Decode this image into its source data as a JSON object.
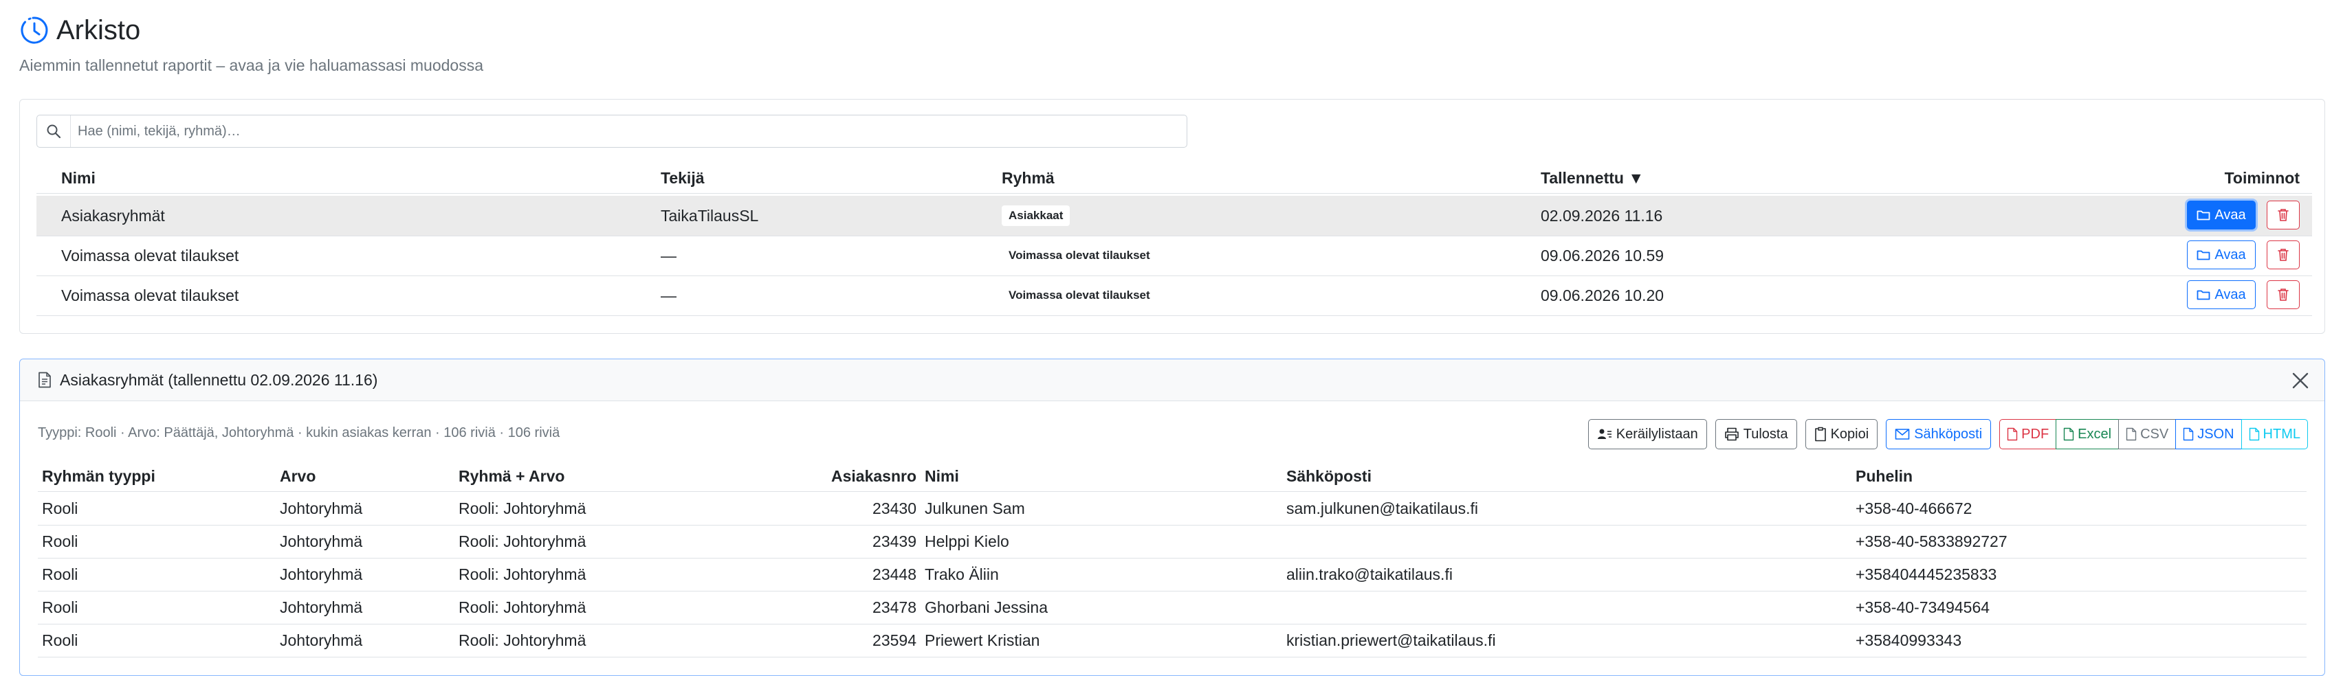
{
  "page": {
    "title": "Arkisto",
    "subtitle": "Aiemmin tallennetut raportit – avaa ja vie haluamassasi muodossa"
  },
  "search": {
    "placeholder": "Hae (nimi, tekijä, ryhmä)…",
    "value": ""
  },
  "archive_table": {
    "headers": {
      "name": "Nimi",
      "author": "Tekijä",
      "group": "Ryhmä",
      "saved": "Tallennettu ▼",
      "actions": "Toiminnot"
    },
    "open_label": "Avaa",
    "rows": [
      {
        "name": "Asiakasryhmät",
        "author": "TaikaTilausSL",
        "group": "Asiakkaat",
        "saved": "02.09.2026 11.16",
        "selected": true
      },
      {
        "name": "Voimassa olevat tilaukset",
        "author": "—",
        "group": "Voimassa olevat tilaukset",
        "saved": "09.06.2026 10.59",
        "selected": false
      },
      {
        "name": "Voimassa olevat tilaukset",
        "author": "—",
        "group": "Voimassa olevat tilaukset",
        "saved": "09.06.2026 10.20",
        "selected": false
      }
    ]
  },
  "report": {
    "title": "Asiakasryhmät (tallennettu 02.09.2026 11.16)",
    "meta": "Tyyppi: Rooli · Arvo: Päättäjä, Johtoryhmä · kukin asiakas kerran · 106 riviä · 106 riviä",
    "buttons": {
      "picklist": "Keräilylistaan",
      "print": "Tulosta",
      "copy": "Kopioi",
      "email": "Sähköposti",
      "pdf": "PDF",
      "excel": "Excel",
      "csv": "CSV",
      "json": "JSON",
      "html": "HTML"
    },
    "headers": {
      "type": "Ryhmän tyyppi",
      "value": "Arvo",
      "group_value": "Ryhmä + Arvo",
      "customer_no": "Asiakasnro",
      "name": "Nimi",
      "email": "Sähköposti",
      "phone": "Puhelin"
    },
    "rows": [
      {
        "type": "Rooli",
        "value": "Johtoryhmä",
        "group_value": "Rooli: Johtoryhmä",
        "customer_no": "23430",
        "name": "Julkunen Sam",
        "email": "sam.julkunen@taikatilaus.fi",
        "phone": "+358-40-466672"
      },
      {
        "type": "Rooli",
        "value": "Johtoryhmä",
        "group_value": "Rooli: Johtoryhmä",
        "customer_no": "23439",
        "name": "Helppi Kielo",
        "email": "",
        "phone": "+358-40-5833892727"
      },
      {
        "type": "Rooli",
        "value": "Johtoryhmä",
        "group_value": "Rooli: Johtoryhmä",
        "customer_no": "23448",
        "name": "Trako Äliin",
        "email": "aliin.trako@taikatilaus.fi",
        "phone": "+358404445235833"
      },
      {
        "type": "Rooli",
        "value": "Johtoryhmä",
        "group_value": "Rooli: Johtoryhmä",
        "customer_no": "23478",
        "name": "Ghorbani Jessina",
        "email": "",
        "phone": "+358-40-73494564"
      },
      {
        "type": "Rooli",
        "value": "Johtoryhmä",
        "group_value": "Rooli: Johtoryhmä",
        "customer_no": "23594",
        "name": "Priewert Kristian",
        "email": "kristian.priewert@taikatilaus.fi",
        "phone": "+35840993343"
      }
    ]
  },
  "icons": {
    "title": "clock-history-icon",
    "search": "search-icon",
    "open": "folder-icon",
    "delete": "trash-icon",
    "report": "file-text-icon",
    "close": "close-icon",
    "picklist": "person-list-icon",
    "print": "printer-icon",
    "copy": "clipboard-icon",
    "email": "envelope-icon",
    "file": "file-icon"
  },
  "colors": {
    "primary": "#0d6efd",
    "danger": "#dc3545",
    "success": "#198754",
    "secondary": "#6c757d",
    "info": "#0dcaf0",
    "selected_row": "#ebebeb"
  }
}
